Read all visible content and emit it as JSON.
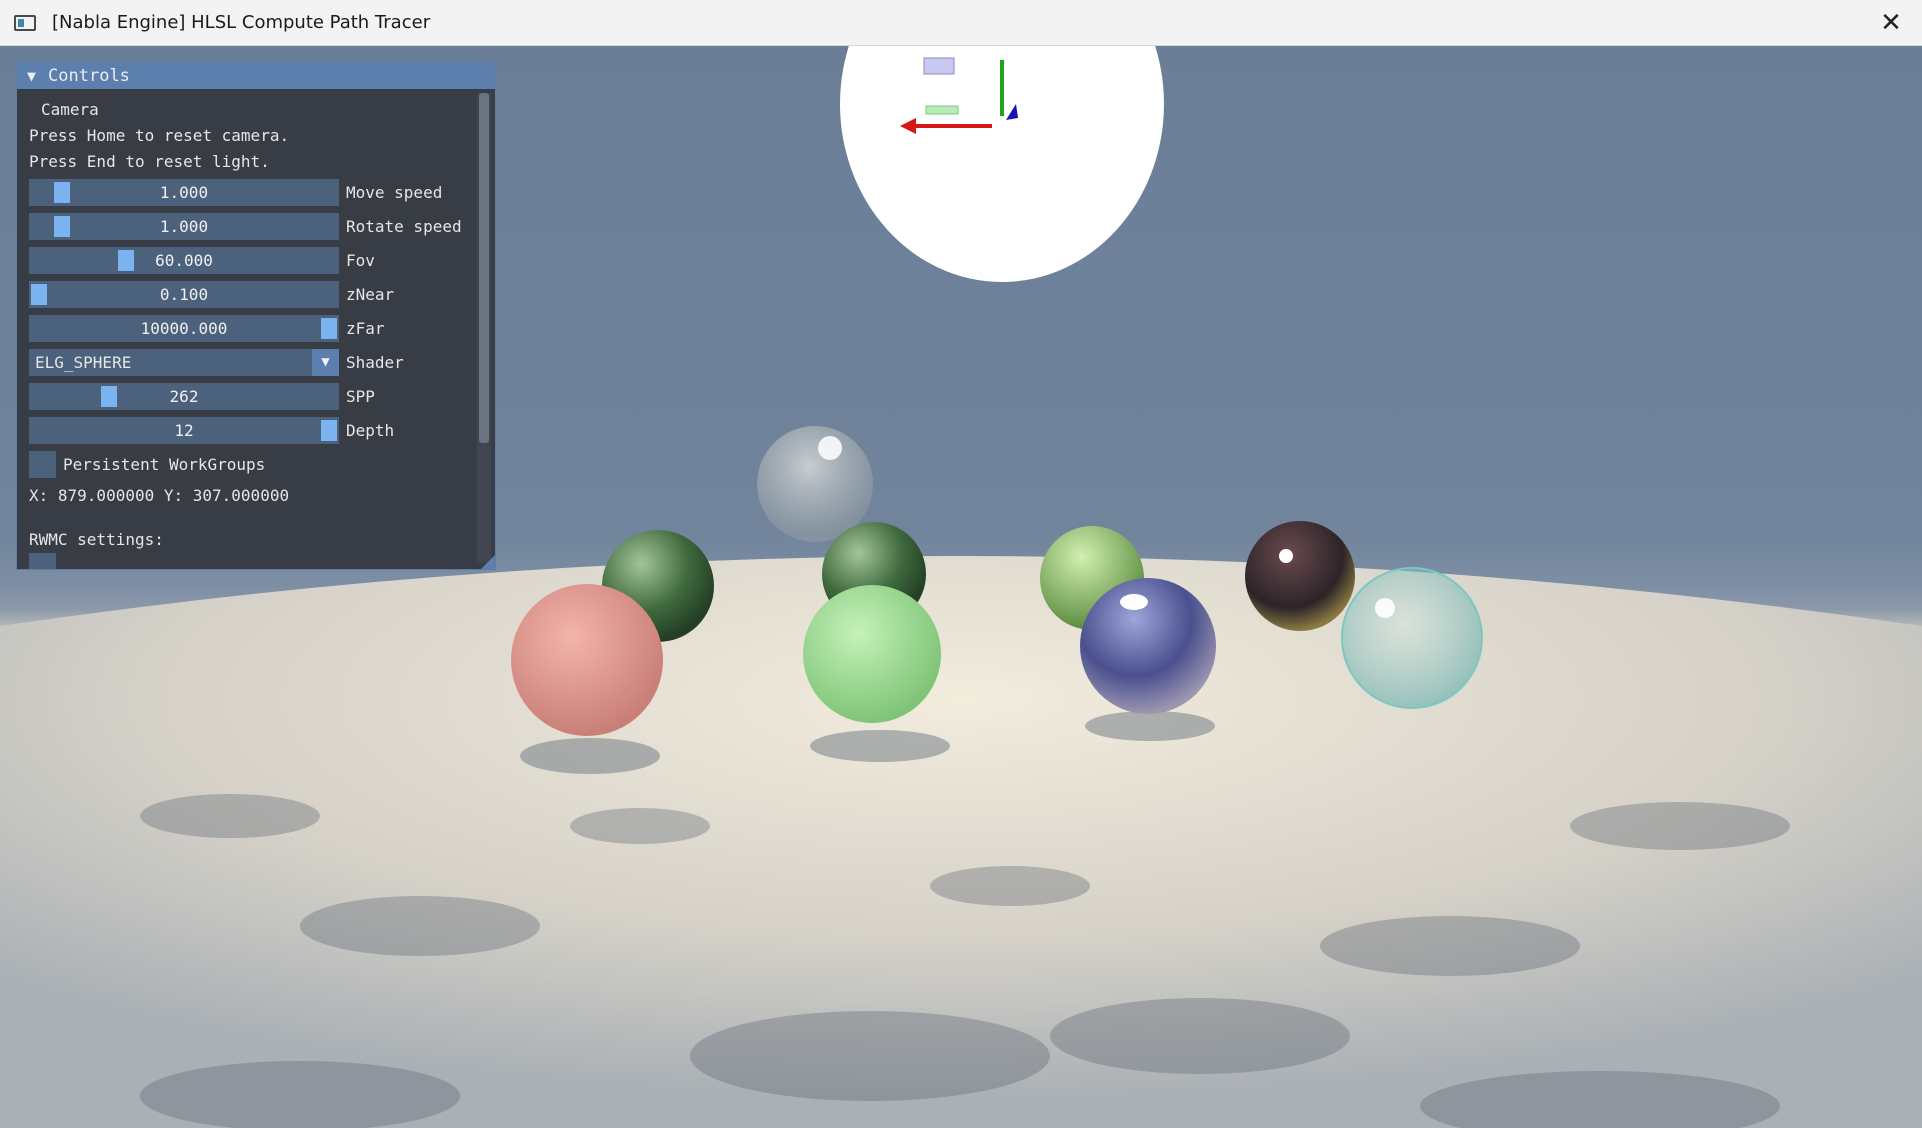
{
  "window": {
    "title": "[Nabla Engine] HLSL Compute Path Tracer",
    "app_icon": "window-icon",
    "close_icon": "✕"
  },
  "panel": {
    "header": {
      "arrow": "▼",
      "title": "Controls"
    },
    "section_camera": "Camera",
    "info_home": "Press Home to reset camera.",
    "info_end": "Press End to reset light.",
    "sliders": [
      {
        "label": "Move speed",
        "value": "1.000",
        "fraction": 0.08
      },
      {
        "label": "Rotate speed",
        "value": "1.000",
        "fraction": 0.08
      },
      {
        "label": "Fov",
        "value": "60.000",
        "fraction": 0.3
      },
      {
        "label": "zNear",
        "value": "0.100",
        "fraction": 0.0
      },
      {
        "label": "zFar",
        "value": "10000.000",
        "fraction": 1.0
      }
    ],
    "shader": {
      "label": "Shader",
      "value": "ELG_SPHERE",
      "arrow": "▼"
    },
    "spp": {
      "label": "SPP",
      "value": "262",
      "fraction": 0.24
    },
    "depth": {
      "label": "Depth",
      "value": "12",
      "fraction": 1.0
    },
    "persistent_workgroups": {
      "label": "Persistent WorkGroups",
      "checked": false
    },
    "coords": "X: 879.000000 Y: 307.000000",
    "rwmc_label": "RWMC settings:"
  },
  "colors": {
    "title_bar": "#f3f3f3",
    "panel_bg": "#363a42",
    "header_bg": "#5c7fae",
    "frame_bg": "#4b617c",
    "grab": "#7ab3f0",
    "sky": "#6b7e98"
  }
}
